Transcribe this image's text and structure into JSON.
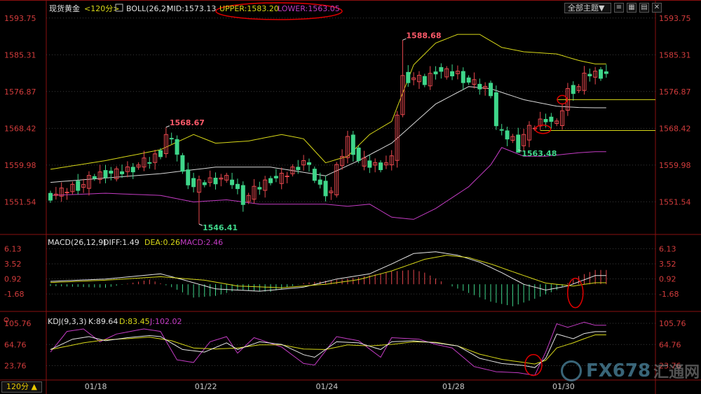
{
  "main_header": {
    "symbol": "现货黄金",
    "period_tag": "<120分>",
    "boll_label": "BOLL(26,2)",
    "mid": "MID:1573.13",
    "upper": "UPPER:1583.20",
    "lower": "LOWER:1563.05"
  },
  "macd_header": {
    "label": "MACD(26,12,9)",
    "diff": "DIFF:1.49",
    "dea": "DEA:0.26",
    "macd": "MACD:2.46"
  },
  "kdj_header": {
    "label": "KDJ(9,3,3)",
    "k": "K:89.64",
    "d": "D:83.45",
    "j": "J:102.02"
  },
  "toolbar": {
    "theme_label": "全部主题▼",
    "period_label": "120分 ▲"
  },
  "watermark": {
    "brand": "FX678",
    "cn": "汇通网"
  },
  "colors": {
    "up": "#e8484e",
    "down": "#3fd68a",
    "mid": "#d8d8d8",
    "upper": "#d8d818",
    "lower": "#c43cc4",
    "axis_text": "#d23c3c",
    "grid": "#3a3a3a",
    "annotation": "#e00000"
  },
  "chart_data": [
    {
      "type": "candlestick",
      "title": "现货黄金 <120分>",
      "y_ticks": [
        1551.54,
        1559.98,
        1568.42,
        1576.87,
        1585.31,
        1593.75
      ],
      "ylim": [
        1545,
        1595
      ],
      "x_ticks": [
        "01/18",
        "01/22",
        "01/24",
        "01/28",
        "01/30"
      ],
      "x_tick_index": [
        8,
        28,
        50,
        73,
        93
      ],
      "n_bars": 102,
      "labels": [
        {
          "text": "1568.67",
          "index": 21,
          "value": 1568.67,
          "kind": "high"
        },
        {
          "text": "1546.41",
          "index": 27,
          "value": 1546.41,
          "kind": "low"
        },
        {
          "text": "1588.68",
          "index": 64,
          "value": 1588.68,
          "kind": "high"
        },
        {
          "text": "1563.48",
          "index": 85,
          "value": 1563.48,
          "kind": "low"
        }
      ],
      "close_anchors": [
        [
          0,
          1553
        ],
        [
          2,
          1553.6
        ],
        [
          4,
          1555
        ],
        [
          6,
          1555.5
        ],
        [
          8,
          1557.5
        ],
        [
          10,
          1558.2
        ],
        [
          12,
          1558
        ],
        [
          14,
          1559
        ],
        [
          16,
          1560
        ],
        [
          18,
          1561
        ],
        [
          20,
          1563
        ],
        [
          21,
          1567
        ],
        [
          22,
          1565
        ],
        [
          23,
          1563
        ],
        [
          24,
          1558
        ],
        [
          26,
          1555
        ],
        [
          27,
          1555.5
        ],
        [
          29,
          1556.5
        ],
        [
          31,
          1557
        ],
        [
          33,
          1556
        ],
        [
          35,
          1552
        ],
        [
          36,
          1553
        ],
        [
          38,
          1555
        ],
        [
          40,
          1557
        ],
        [
          42,
          1557
        ],
        [
          44,
          1559
        ],
        [
          46,
          1561
        ],
        [
          48,
          1557
        ],
        [
          49,
          1555
        ],
        [
          50,
          1554
        ],
        [
          51,
          1554
        ],
        [
          52,
          1559
        ],
        [
          54,
          1566
        ],
        [
          56,
          1561
        ],
        [
          58,
          1560
        ],
        [
          60,
          1560
        ],
        [
          62,
          1561
        ],
        [
          63,
          1572
        ],
        [
          64,
          1580
        ],
        [
          66,
          1580
        ],
        [
          68,
          1579
        ],
        [
          70,
          1582
        ],
        [
          72,
          1581
        ],
        [
          74,
          1581
        ],
        [
          76,
          1579
        ],
        [
          78,
          1578
        ],
        [
          80,
          1577
        ],
        [
          81,
          1569
        ],
        [
          82,
          1567
        ],
        [
          84,
          1566
        ],
        [
          85,
          1564
        ],
        [
          86,
          1567
        ],
        [
          88,
          1569
        ],
        [
          90,
          1571
        ],
        [
          91,
          1570
        ],
        [
          92,
          1569
        ],
        [
          93,
          1573
        ],
        [
          94,
          1577
        ],
        [
          96,
          1578
        ],
        [
          97,
          1580
        ],
        [
          98,
          1581
        ],
        [
          99,
          1581
        ],
        [
          101,
          1581
        ]
      ],
      "boll_mid": [
        [
          0,
          1556
        ],
        [
          10,
          1557
        ],
        [
          20,
          1558
        ],
        [
          30,
          1559.5
        ],
        [
          40,
          1559.5
        ],
        [
          50,
          1557.5
        ],
        [
          56,
          1561
        ],
        [
          62,
          1565
        ],
        [
          70,
          1574
        ],
        [
          76,
          1578
        ],
        [
          80,
          1577.5
        ],
        [
          86,
          1575
        ],
        [
          92,
          1573.5
        ],
        [
          96,
          1573.2
        ],
        [
          99,
          1573.13
        ]
      ],
      "boll_upper": [
        [
          0,
          1559
        ],
        [
          10,
          1561
        ],
        [
          20,
          1563.5
        ],
        [
          26,
          1567
        ],
        [
          30,
          1565
        ],
        [
          36,
          1565.5
        ],
        [
          42,
          1567
        ],
        [
          46,
          1566
        ],
        [
          50,
          1560.5
        ],
        [
          54,
          1562
        ],
        [
          58,
          1567
        ],
        [
          62,
          1570
        ],
        [
          66,
          1583
        ],
        [
          70,
          1588
        ],
        [
          74,
          1590
        ],
        [
          78,
          1590
        ],
        [
          82,
          1587
        ],
        [
          86,
          1586
        ],
        [
          92,
          1585.5
        ],
        [
          96,
          1584
        ],
        [
          99,
          1583.2
        ]
      ],
      "boll_lower": [
        [
          0,
          1553
        ],
        [
          10,
          1553.5
        ],
        [
          20,
          1553
        ],
        [
          26,
          1551.5
        ],
        [
          32,
          1552
        ],
        [
          38,
          1551
        ],
        [
          46,
          1551
        ],
        [
          50,
          1551
        ],
        [
          54,
          1550.5
        ],
        [
          58,
          1551
        ],
        [
          62,
          1548
        ],
        [
          66,
          1547.5
        ],
        [
          70,
          1550
        ],
        [
          76,
          1555
        ],
        [
          80,
          1560
        ],
        [
          82,
          1564
        ],
        [
          86,
          1562
        ],
        [
          90,
          1562
        ],
        [
          96,
          1562.8
        ],
        [
          99,
          1563.05
        ]
      ],
      "annotations": [
        {
          "kind": "ellipse",
          "target": "header UPPER/LOWER"
        },
        {
          "kind": "ellipse",
          "index": 93,
          "value": 1575
        },
        {
          "kind": "ellipse",
          "index": 89,
          "value": 1568.2
        },
        {
          "kind": "hline",
          "value": 1575,
          "from_index": 92
        },
        {
          "kind": "hline",
          "value": 1567.9,
          "from_index": 89
        }
      ]
    },
    {
      "type": "macd",
      "title": "MACD(26,12,9)",
      "y_ticks": [
        -1.68,
        0.92,
        3.52,
        6.13
      ],
      "ylim": [
        -4.2,
        7.5
      ],
      "diff": [
        [
          0,
          0.5
        ],
        [
          10,
          0.9
        ],
        [
          20,
          1.8
        ],
        [
          24,
          0.8
        ],
        [
          30,
          -0.8
        ],
        [
          38,
          -1.2
        ],
        [
          46,
          -0.5
        ],
        [
          52,
          0.9
        ],
        [
          58,
          1.8
        ],
        [
          62,
          3.5
        ],
        [
          66,
          5.3
        ],
        [
          70,
          5.6
        ],
        [
          74,
          5.0
        ],
        [
          78,
          3.8
        ],
        [
          82,
          2.0
        ],
        [
          86,
          0.0
        ],
        [
          90,
          -1.0
        ],
        [
          94,
          -0.3
        ],
        [
          99,
          1.49
        ]
      ],
      "dea": [
        [
          0,
          0.3
        ],
        [
          10,
          0.7
        ],
        [
          20,
          1.3
        ],
        [
          28,
          0.7
        ],
        [
          34,
          -0.3
        ],
        [
          42,
          -0.6
        ],
        [
          50,
          0.0
        ],
        [
          56,
          0.8
        ],
        [
          62,
          2.3
        ],
        [
          68,
          4.3
        ],
        [
          72,
          5.0
        ],
        [
          76,
          4.6
        ],
        [
          80,
          3.5
        ],
        [
          86,
          1.5
        ],
        [
          90,
          0.2
        ],
        [
          95,
          -0.3
        ],
        [
          99,
          0.26
        ]
      ],
      "hist": [
        [
          0,
          -0.3
        ],
        [
          10,
          -0.6
        ],
        [
          18,
          0.8
        ],
        [
          22,
          -0.5
        ],
        [
          26,
          -2.3
        ],
        [
          30,
          -2.0
        ],
        [
          34,
          -1.0
        ],
        [
          40,
          -1.3
        ],
        [
          46,
          0.2
        ],
        [
          52,
          0.8
        ],
        [
          56,
          1.2
        ],
        [
          62,
          2.2
        ],
        [
          66,
          2.5
        ],
        [
          68,
          2.0
        ],
        [
          72,
          0.0
        ],
        [
          76,
          -1.5
        ],
        [
          80,
          -3.0
        ],
        [
          84,
          -3.8
        ],
        [
          88,
          -2.5
        ],
        [
          92,
          -1.0
        ],
        [
          96,
          1.4
        ],
        [
          99,
          2.46
        ]
      ],
      "annotations": [
        {
          "kind": "ellipse",
          "index": 95,
          "value": -1.5
        }
      ]
    },
    {
      "type": "kdj",
      "title": "KDJ(9,3,3)",
      "y_ticks": [
        23.76,
        64.76,
        105.76
      ],
      "ylim": [
        0,
        118
      ],
      "k": [
        [
          0,
          55
        ],
        [
          4,
          75
        ],
        [
          7,
          80
        ],
        [
          10,
          72
        ],
        [
          14,
          78
        ],
        [
          18,
          82
        ],
        [
          20,
          80
        ],
        [
          24,
          55
        ],
        [
          28,
          50
        ],
        [
          32,
          68
        ],
        [
          34,
          55
        ],
        [
          38,
          70
        ],
        [
          42,
          65
        ],
        [
          46,
          45
        ],
        [
          48,
          40
        ],
        [
          52,
          70
        ],
        [
          56,
          68
        ],
        [
          60,
          55
        ],
        [
          62,
          70
        ],
        [
          66,
          72
        ],
        [
          70,
          68
        ],
        [
          74,
          62
        ],
        [
          78,
          38
        ],
        [
          82,
          28
        ],
        [
          86,
          24
        ],
        [
          88,
          20
        ],
        [
          90,
          38
        ],
        [
          92,
          85
        ],
        [
          95,
          76
        ],
        [
          97,
          86
        ],
        [
          99,
          89.64
        ]
      ],
      "d": [
        [
          0,
          55
        ],
        [
          6,
          68
        ],
        [
          10,
          74
        ],
        [
          14,
          76
        ],
        [
          18,
          79
        ],
        [
          22,
          72
        ],
        [
          26,
          58
        ],
        [
          30,
          56
        ],
        [
          34,
          58
        ],
        [
          38,
          64
        ],
        [
          42,
          64
        ],
        [
          46,
          56
        ],
        [
          50,
          55
        ],
        [
          54,
          64
        ],
        [
          58,
          62
        ],
        [
          62,
          65
        ],
        [
          66,
          70
        ],
        [
          70,
          69
        ],
        [
          74,
          62
        ],
        [
          78,
          46
        ],
        [
          82,
          36
        ],
        [
          86,
          30
        ],
        [
          88,
          27
        ],
        [
          90,
          34
        ],
        [
          92,
          58
        ],
        [
          95,
          68
        ],
        [
          97,
          76
        ],
        [
          99,
          83.45
        ]
      ],
      "j": [
        [
          0,
          50
        ],
        [
          3,
          90
        ],
        [
          6,
          95
        ],
        [
          9,
          70
        ],
        [
          12,
          85
        ],
        [
          17,
          95
        ],
        [
          20,
          90
        ],
        [
          23,
          35
        ],
        [
          26,
          30
        ],
        [
          29,
          70
        ],
        [
          32,
          80
        ],
        [
          34,
          48
        ],
        [
          37,
          78
        ],
        [
          42,
          60
        ],
        [
          46,
          28
        ],
        [
          48,
          25
        ],
        [
          52,
          80
        ],
        [
          56,
          72
        ],
        [
          60,
          40
        ],
        [
          62,
          78
        ],
        [
          67,
          75
        ],
        [
          70,
          65
        ],
        [
          73,
          58
        ],
        [
          77,
          22
        ],
        [
          81,
          12
        ],
        [
          85,
          10
        ],
        [
          88,
          5
        ],
        [
          90,
          50
        ],
        [
          92,
          105
        ],
        [
          94,
          98
        ],
        [
          97,
          108
        ],
        [
          99,
          102.02
        ]
      ],
      "annotations": [
        {
          "kind": "ellipse",
          "index": 87,
          "value": 25
        }
      ]
    }
  ]
}
